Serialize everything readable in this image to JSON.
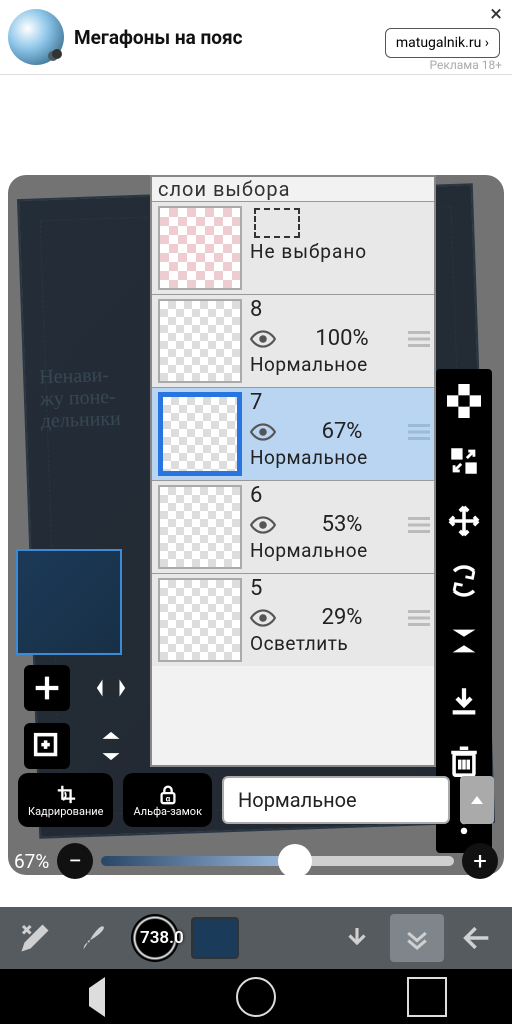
{
  "ad": {
    "title": "Мегафоны на пояс",
    "domain": "matugalnik.ru",
    "meta": "Реклама  18+"
  },
  "sketch_text": "Ненави-\nжу поне-\nдельники",
  "layers_header": "слои  выбора",
  "no_selection": "Не  выбрано",
  "layers": [
    {
      "num": "8",
      "opacity": "100%",
      "mode": "Нормальное"
    },
    {
      "num": "7",
      "opacity": "67%",
      "mode": "Нормальное"
    },
    {
      "num": "6",
      "opacity": "53%",
      "mode": "Нормальное"
    },
    {
      "num": "5",
      "opacity": "29%",
      "mode": "Осветлить"
    }
  ],
  "crop_label": "Кадрирование",
  "alpha_label": "Альфа-замок",
  "blend_mode": "Нормальное",
  "opacity_value": "67%",
  "brush_size": "738.0"
}
